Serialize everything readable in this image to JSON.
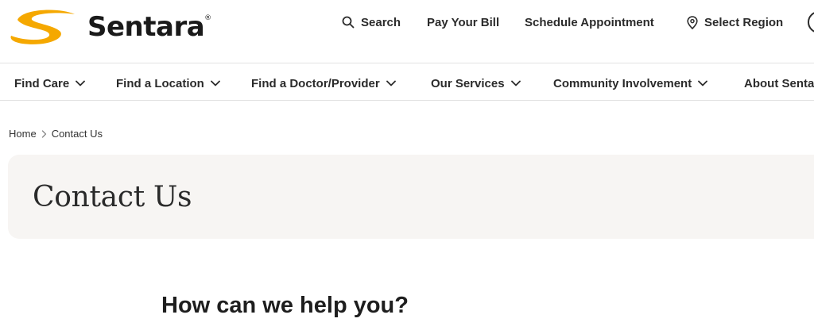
{
  "brand": {
    "name": "Sentara",
    "reg_mark": "®",
    "accent_color": "#F5A800"
  },
  "utility_nav": {
    "search": "Search",
    "pay_bill": "Pay Your Bill",
    "schedule": "Schedule Appointment",
    "region": "Select Region"
  },
  "main_nav": {
    "items": [
      {
        "label": "Find Care"
      },
      {
        "label": "Find a Location"
      },
      {
        "label": "Find a Doctor/Provider"
      },
      {
        "label": "Our Services"
      },
      {
        "label": "Community Involvement"
      },
      {
        "label": "About Senta"
      }
    ]
  },
  "breadcrumb": {
    "home": "Home",
    "current": "Contact Us"
  },
  "page": {
    "title": "Contact Us",
    "help_heading": "How can we help you?"
  }
}
